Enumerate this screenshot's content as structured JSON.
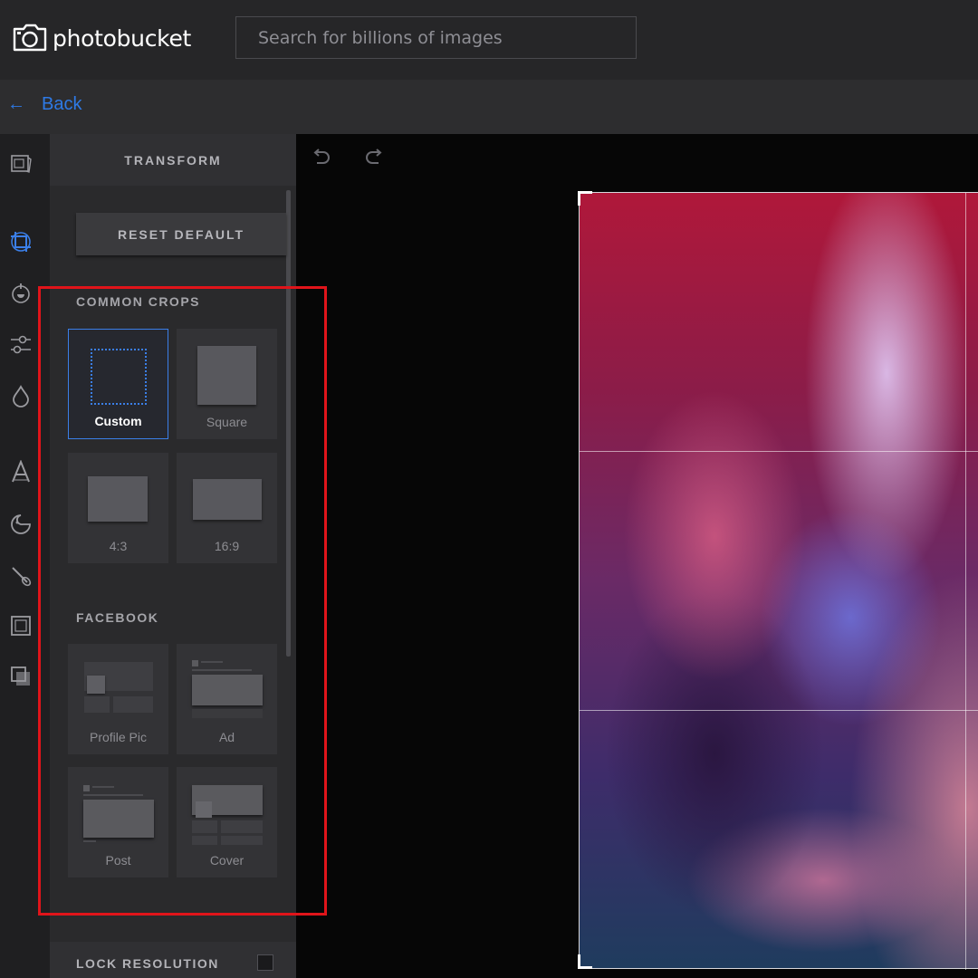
{
  "app": {
    "logo_text": "photobucket",
    "search_placeholder": "Search for billions of images"
  },
  "nav": {
    "back_label": "Back"
  },
  "toolbar": {
    "tools": [
      "image-icon",
      "crop-icon",
      "filter-icon",
      "adjust-icon",
      "drop-icon",
      "text-icon",
      "sticker-icon",
      "brush-icon",
      "frame-icon",
      "overlay-icon"
    ],
    "active_tool": "crop-icon"
  },
  "panel": {
    "title": "TRANSFORM",
    "reset_label": "RESET DEFAULT",
    "common_crops": {
      "title": "COMMON CROPS",
      "items": [
        {
          "label": "Custom",
          "selected": true
        },
        {
          "label": "Square",
          "selected": false
        },
        {
          "label": "4:3",
          "selected": false
        },
        {
          "label": "16:9",
          "selected": false
        }
      ]
    },
    "facebook": {
      "title": "FACEBOOK",
      "items": [
        {
          "label": "Profile Pic"
        },
        {
          "label": "Ad"
        },
        {
          "label": "Post"
        },
        {
          "label": "Cover"
        }
      ]
    },
    "lock_resolution": {
      "label": "LOCK RESOLUTION",
      "checked": false
    }
  },
  "colors": {
    "accent": "#3b7fe8",
    "highlight": "#e0141a",
    "topbar": "#262628",
    "panel": "#2a2a2c"
  }
}
